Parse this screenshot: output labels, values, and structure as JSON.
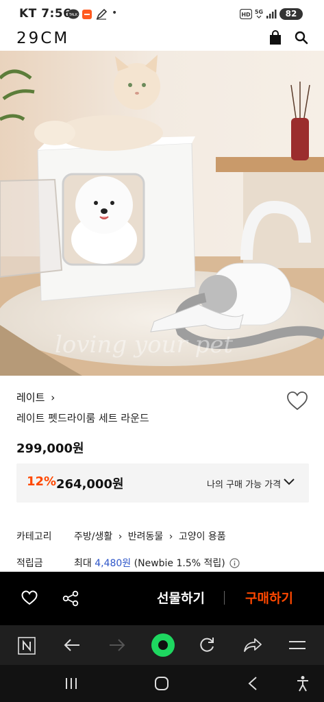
{
  "status_bar": {
    "carrier": "KT",
    "time": "7:56",
    "battery": "82",
    "hd_label": "HD",
    "network_label": "5G",
    "talk_label": "TALK",
    "dot": "•",
    "icons": [
      "kakaotalk-icon",
      "app-notification-icon",
      "pen-icon",
      "dot-icon",
      "hd-voice-icon",
      "5g-icon",
      "signal-icon",
      "battery-icon"
    ]
  },
  "header": {
    "logo": "29CM",
    "icons": [
      "shopping-bag-icon",
      "search-icon"
    ]
  },
  "hero": {
    "watermark": "loving your pet"
  },
  "product": {
    "brand": "레이트",
    "brand_chevron": "›",
    "name": "레이트 펫드라이룸 세트 라운드",
    "price": "299,000원",
    "discount_rate": "12%",
    "discount_price": "264,000원",
    "my_price_label": "나의 구매 가능 가격"
  },
  "meta": {
    "category_label": "카테고리",
    "categories": [
      "주방/생활",
      "반려동물",
      "고양이 용품"
    ],
    "points_label": "적립금",
    "points_prefix": "최대",
    "points_amount": "4,480원",
    "points_suffix": "(Newbie 1.5% 적립)"
  },
  "purchase_bar": {
    "gift_label": "선물하기",
    "buy_label": "구매하기",
    "icons": [
      "heart-icon",
      "share-icon"
    ]
  },
  "browser_bar": {
    "icons": [
      "naver-icon",
      "back-arrow-icon",
      "forward-arrow-icon",
      "green-dot-icon",
      "refresh-icon",
      "share-arrow-icon",
      "menu-icon"
    ]
  },
  "nav_bar": {
    "icons": [
      "recent-apps-icon",
      "home-icon",
      "back-icon",
      "accessibility-icon"
    ]
  },
  "colors": {
    "accent": "#ff4800",
    "points_blue": "#2e56c9",
    "purchase_bar_bg": "#000000",
    "green_dot": "#1ed760"
  }
}
